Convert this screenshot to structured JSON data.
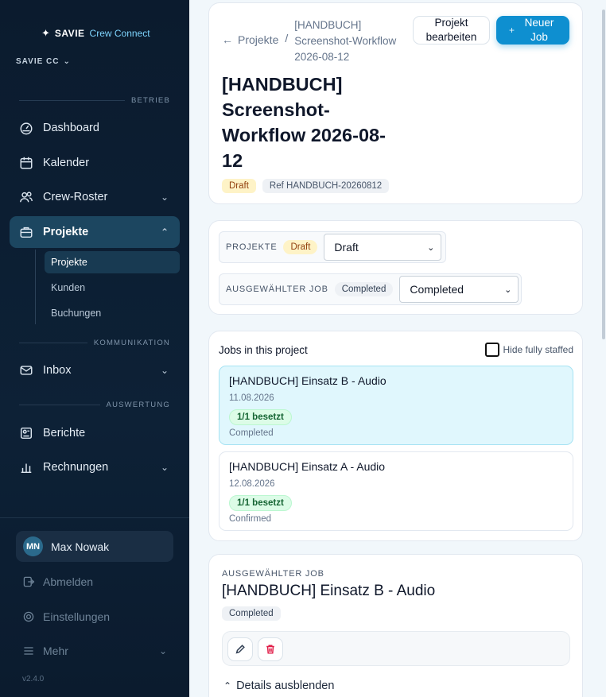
{
  "sidebar": {
    "brand_strong": "SAVIE",
    "brand_light": "Crew Connect",
    "org": "SAVIE CC",
    "sections": {
      "betrieb": "BETRIEB",
      "kommunikation": "KOMMUNIKATION",
      "auswertung": "AUSWERTUNG"
    },
    "items": {
      "dashboard": "Dashboard",
      "kalender": "Kalender",
      "crew_roster": "Crew-Roster",
      "projekte": "Projekte",
      "inbox": "Inbox",
      "berichte": "Berichte",
      "rechnungen": "Rechnungen"
    },
    "sub_items": {
      "projekte": "Projekte",
      "kunden": "Kunden",
      "buchungen": "Buchungen"
    },
    "user": {
      "initials": "MN",
      "name": "Max Nowak"
    },
    "footer": {
      "abmelden": "Abmelden",
      "einstellungen": "Einstellungen",
      "mehr": "Mehr",
      "version": "v2.4.0"
    }
  },
  "header": {
    "back_label": "Projekte",
    "separator": "/",
    "current_crumb": "[HANDBUCH] Screenshot-Workflow 2026-08-12",
    "edit_button": "Projekt bearbeiten",
    "new_job_button": "Neuer Job",
    "title": "[HANDBUCH] Screenshot-Workflow 2026-08-12",
    "status_badge": "Draft",
    "ref_badge": "Ref HANDBUCH-20260812"
  },
  "status_panel": {
    "project_label": "PROJEKTE",
    "project_badge": "Draft",
    "project_select_value": "Draft",
    "job_label": "AUSGEWÄHLTER JOB",
    "job_badge": "Completed",
    "job_select_value": "Completed"
  },
  "jobs": {
    "heading": "Jobs in this project",
    "hide_staffed_label": "Hide fully staffed",
    "list": [
      {
        "title": "[HANDBUCH] Einsatz B - Audio",
        "date": "11.08.2026",
        "staffing": "1/1 besetzt",
        "status": "Completed"
      },
      {
        "title": "[HANDBUCH] Einsatz A - Audio",
        "date": "12.08.2026",
        "staffing": "1/1 besetzt",
        "status": "Confirmed"
      }
    ]
  },
  "selected_job": {
    "label": "AUSGEWÄHLTER JOB",
    "title": "[HANDBUCH] Einsatz B - Audio",
    "badge": "Completed",
    "details_toggle": "Details ausblenden"
  }
}
